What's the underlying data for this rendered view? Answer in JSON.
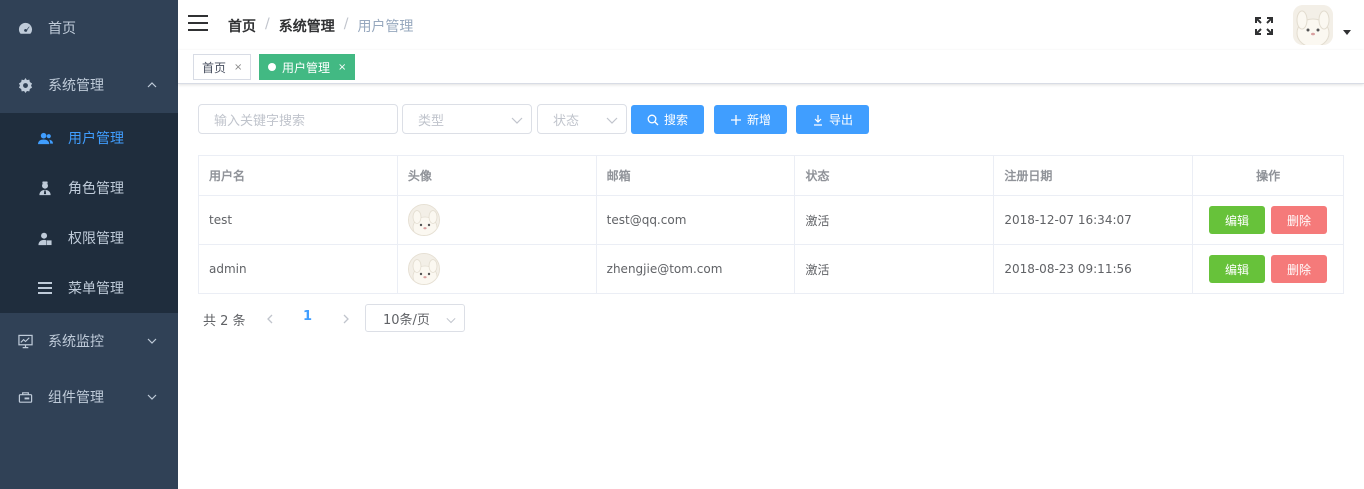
{
  "sidebar": {
    "items": [
      {
        "label": "首页",
        "icon": "dashboard-icon"
      },
      {
        "label": "系统管理",
        "icon": "gear-icon",
        "expanded": true
      },
      {
        "label": "系统监控",
        "icon": "monitor-icon"
      },
      {
        "label": "组件管理",
        "icon": "component-icon"
      }
    ],
    "sub_items": [
      {
        "label": "用户管理",
        "icon": "user-icon",
        "active": true
      },
      {
        "label": "角色管理",
        "icon": "role-icon"
      },
      {
        "label": "权限管理",
        "icon": "permission-icon"
      },
      {
        "label": "菜单管理",
        "icon": "menu-icon"
      }
    ]
  },
  "header": {
    "breadcrumb": [
      "首页",
      "系统管理",
      "用户管理"
    ]
  },
  "tags": [
    {
      "label": "首页",
      "close": "×"
    },
    {
      "label": "用户管理",
      "close": "×",
      "active": true
    }
  ],
  "filters": {
    "search_placeholder": "输入关键字搜索",
    "type_placeholder": "类型",
    "status_placeholder": "状态",
    "search_label": "搜索",
    "add_label": "新增",
    "export_label": "导出"
  },
  "table": {
    "headers": [
      "用户名",
      "头像",
      "邮箱",
      "状态",
      "注册日期",
      "操作"
    ],
    "rows": [
      {
        "username": "test",
        "email": "test@qq.com",
        "status": "激活",
        "date": "2018-12-07 16:34:07",
        "edit": "编辑",
        "delete": "删除"
      },
      {
        "username": "admin",
        "email": "zhengjie@tom.com",
        "status": "激活",
        "date": "2018-08-23 09:11:56",
        "edit": "编辑",
        "delete": "删除"
      }
    ]
  },
  "pagination": {
    "total": "共 2 条",
    "current": "1",
    "page_size": "10条/页"
  },
  "colors": {
    "sidebar_bg": "#304156",
    "submenu_bg": "#1f2d3d",
    "primary": "#409eff",
    "success": "#67c23a",
    "danger": "#f56c6c",
    "tag_active": "#42b983"
  }
}
